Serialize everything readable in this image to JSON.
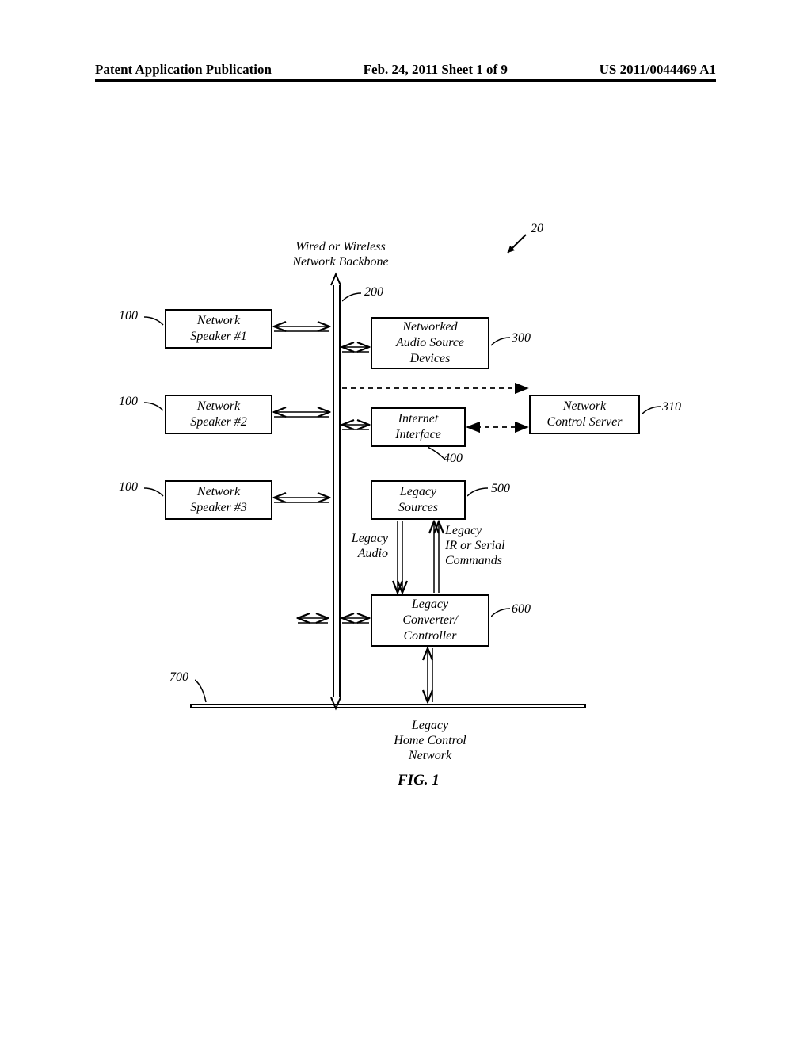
{
  "header": {
    "left": "Patent Application Publication",
    "center": "Feb. 24, 2011  Sheet 1 of 9",
    "right": "US 2011/0044469 A1"
  },
  "backbone_label": "Wired or Wireless\nNetwork Backbone",
  "speakers": [
    {
      "text": "Network\nSpeaker #1",
      "ref": "100"
    },
    {
      "text": "Network\nSpeaker #2",
      "ref": "100"
    },
    {
      "text": "Network\nSpeaker #3",
      "ref": "100"
    }
  ],
  "audio_source": {
    "text": "Networked\nAudio Source\nDevices",
    "ref": "300"
  },
  "control_server": {
    "text": "Network\nControl Server",
    "ref": "310"
  },
  "internet_iface": {
    "text": "Internet\nInterface",
    "ref": "400"
  },
  "legacy_sources": {
    "text": "Legacy\nSources",
    "ref": "500"
  },
  "legacy_converter": {
    "text": "Legacy\nConverter/\nController",
    "ref": "600"
  },
  "legacy_audio_label": "Legacy\nAudio",
  "legacy_ir_label": "Legacy\nIR or Serial\nCommands",
  "legacy_network_label": "Legacy\nHome Control\nNetwork",
  "system_ref": "20",
  "backbone_ref": "200",
  "legacy_line_ref": "700",
  "figure_caption": "FIG. 1"
}
